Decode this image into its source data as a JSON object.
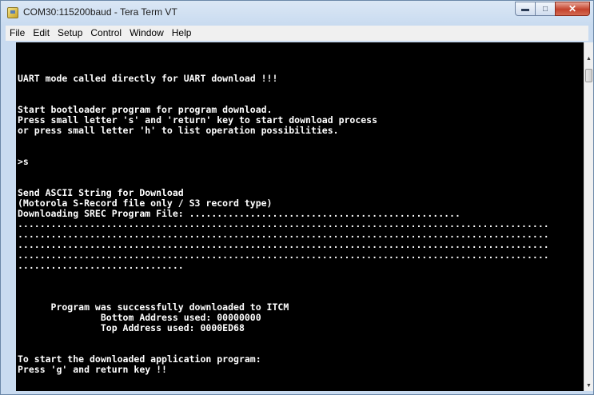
{
  "window": {
    "title": "COM30:115200baud - Tera Term VT"
  },
  "menu": [
    "File",
    "Edit",
    "Setup",
    "Control",
    "Window",
    "Help"
  ],
  "terminal": {
    "lines": [
      "",
      "",
      "",
      "UART mode called directly for UART download !!!",
      "",
      "",
      "Start bootloader program for program download.",
      "Press small letter 's' and 'return' key to start download process",
      "or press small letter 'h' to list operation possibilities.",
      "",
      "",
      ">s",
      "",
      "",
      "Send ASCII String for Download",
      "(Motorola S-Record file only / S3 record type)",
      "Downloading SREC Program File: .................................................",
      "................................................................................................",
      "................................................................................................",
      "................................................................................................",
      "................................................................................................",
      "..............................",
      "",
      "",
      "",
      "      Program was successfully downloaded to ITCM",
      "               Bottom Address used: 00000000",
      "               Top Address used: 0000ED68",
      "",
      "",
      "To start the downloaded application program:",
      "Press 'g' and return key !!",
      "",
      "",
      ">"
    ]
  },
  "icons": {
    "app": "tera-term-icon",
    "minimize": "minimize-icon",
    "maximize": "maximize-icon",
    "close": "close-icon",
    "scroll_up": "arrow-up-icon",
    "scroll_down": "arrow-down-icon"
  }
}
